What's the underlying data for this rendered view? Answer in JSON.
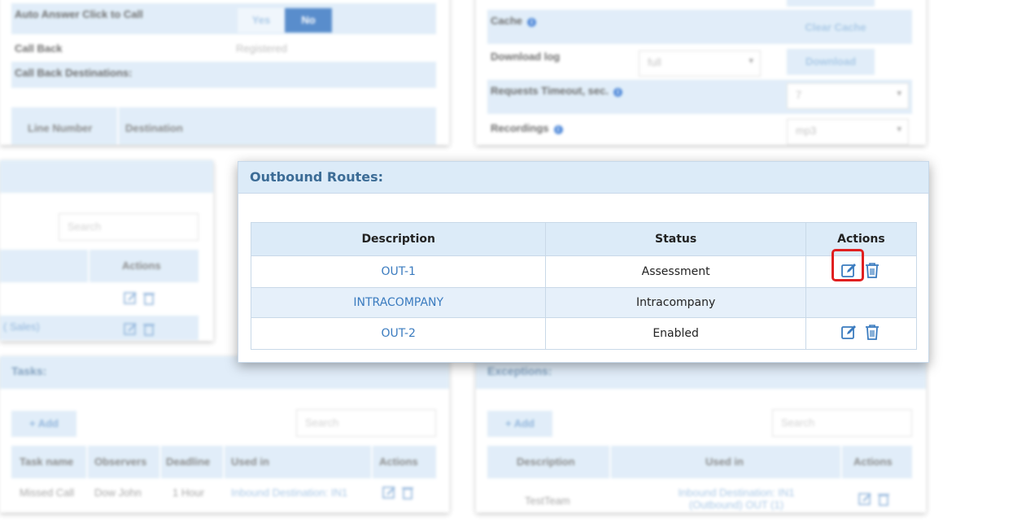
{
  "background": {
    "top_left": {
      "auto_answer_label": "Auto Answer Click to Call",
      "yes_label": "Yes",
      "no_label": "No",
      "call_back_label": "Call Back",
      "call_back_value": "Registered",
      "call_back_dest_label": "Call Back Destinations:",
      "col_line_number": "Line Number",
      "col_destination": "Destination"
    },
    "top_right": {
      "cache_label": "Cache",
      "clear_cache_label": "Clear Cache",
      "download_log_label": "Download log",
      "download_log_value": "full",
      "download_label": "Download",
      "timeout_label": "Requests Timeout, sec.",
      "timeout_value": "7",
      "recordings_label": "Recordings",
      "recordings_value": "mp3"
    },
    "mid_left": {
      "search_placeholder": "Search",
      "actions_header": "Actions",
      "row_text": "( Sales)"
    },
    "tasks": {
      "title": "Tasks:",
      "add_label": "+ Add",
      "search_placeholder": "Search",
      "columns": [
        "Task name",
        "Observers",
        "Deadline",
        "Used in",
        "Actions"
      ],
      "row": [
        "Missed Call",
        "Dow John",
        "1 Hour",
        "Inbound Destination: IN1"
      ]
    },
    "exceptions": {
      "title": "Exceptions:",
      "add_label": "+ Add",
      "search_placeholder": "Search",
      "columns": [
        "Description",
        "Used in",
        "Actions"
      ],
      "row": [
        "TestTeam",
        "Inbound Destination: IN1 (Outbound) OUT (1)"
      ]
    }
  },
  "modal": {
    "title": "Outbound Routes:",
    "columns": {
      "description": "Description",
      "status": "Status",
      "actions": "Actions"
    },
    "rows": [
      {
        "description": "OUT-1",
        "status": "Assessment"
      },
      {
        "description": "INTRACOMPANY",
        "status": "Intracompany"
      },
      {
        "description": "OUT-2",
        "status": "Enabled"
      }
    ]
  },
  "colors": {
    "header_bg": "#dcebf8",
    "link": "#3a7bbf",
    "highlight": "#e02020"
  },
  "icons": [
    "edit-icon",
    "trash-icon",
    "info-icon"
  ]
}
